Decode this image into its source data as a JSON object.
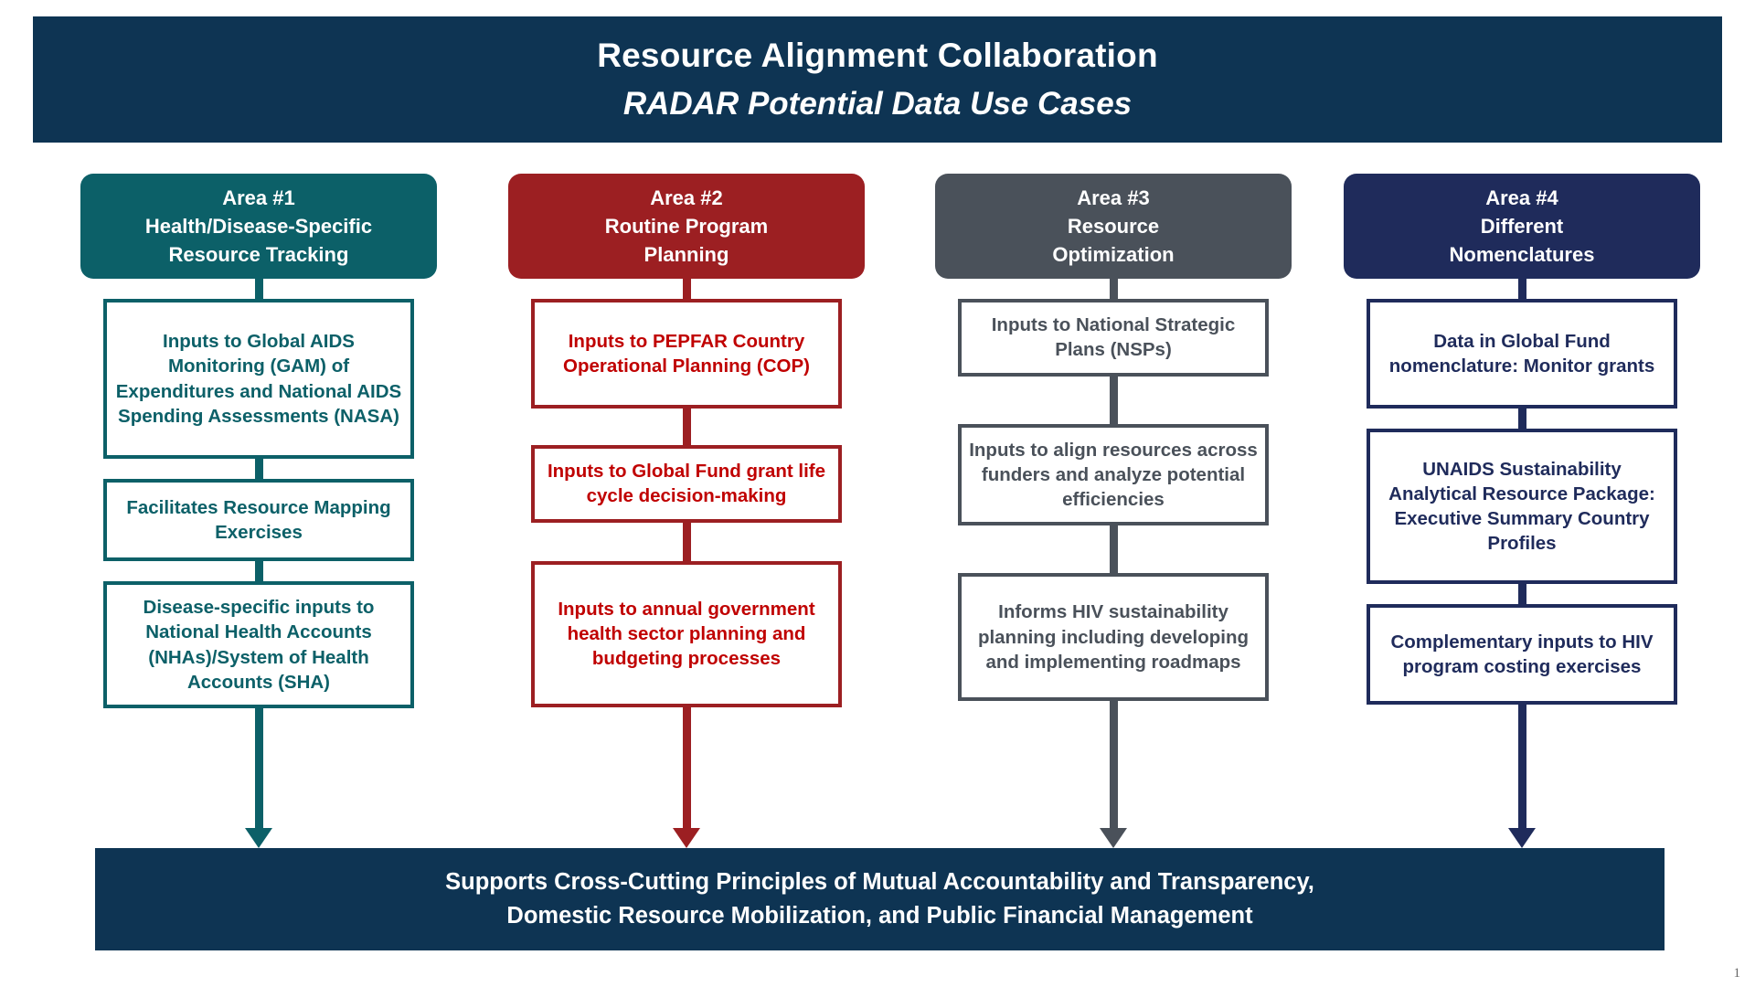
{
  "title": {
    "line1": "Resource Alignment Collaboration",
    "line2": "RADAR Potential Data Use Cases"
  },
  "colors": {
    "banner_navy": "#0E3453",
    "area1_teal": "#0C6068",
    "area1_text": "#0C6068",
    "area2_red": "#9C1F22",
    "area2_text": "#C00000",
    "area3_gray": "#4A515A",
    "area3_text": "#4A515A",
    "area4_navy": "#1F2B5B",
    "area4_text": "#1F2B5B"
  },
  "columns": [
    {
      "header": "Area #1\nHealth/Disease-Specific\nResource Tracking",
      "header_lines": [
        "Area #1",
        "Health/Disease-Specific",
        "Resource Tracking"
      ],
      "accent": "#0C6068",
      "text_color": "#0C6068",
      "items": [
        "Inputs to Global AIDS Monitoring (GAM) of Expenditures and National AIDS Spending Assessments (NASA)",
        "Facilitates Resource Mapping Exercises",
        "Disease-specific inputs to National Health Accounts (NHAs)/System of Health Accounts (SHA)"
      ]
    },
    {
      "header": "Area #2\nRoutine Program\nPlanning",
      "header_lines": [
        "Area #2",
        "Routine Program",
        "Planning"
      ],
      "accent": "#9C1F22",
      "text_color": "#C00000",
      "items": [
        "Inputs to PEPFAR Country Operational Planning (COP)",
        "Inputs to Global Fund grant life cycle decision-making",
        "Inputs to annual government health sector planning and budgeting processes"
      ]
    },
    {
      "header": "Area #3\nResource\nOptimization",
      "header_lines": [
        "Area #3",
        "Resource",
        "Optimization"
      ],
      "accent": "#4A515A",
      "text_color": "#4A515A",
      "items": [
        "Inputs to National Strategic Plans (NSPs)",
        "Inputs to align resources across funders and analyze potential efficiencies",
        "Informs HIV sustainability planning including developing and implementing roadmaps"
      ]
    },
    {
      "header": "Area #4\nDifferent\nNomenclatures",
      "header_lines": [
        "Area #4",
        "Different",
        "Nomenclatures"
      ],
      "accent": "#1F2B5B",
      "text_color": "#1F2B5B",
      "items": [
        "Data in Global Fund nomenclature: Monitor grants",
        "UNAIDS Sustainability Analytical Resource Package: Executive Summary Country Profiles",
        "Complementary inputs to HIV program costing exercises"
      ]
    }
  ],
  "footer": {
    "line1": "Supports Cross-Cutting Principles of Mutual Accountability and Transparency,",
    "line2": "Domestic Resource Mobilization, and Public Financial Management"
  },
  "page_number": "1"
}
